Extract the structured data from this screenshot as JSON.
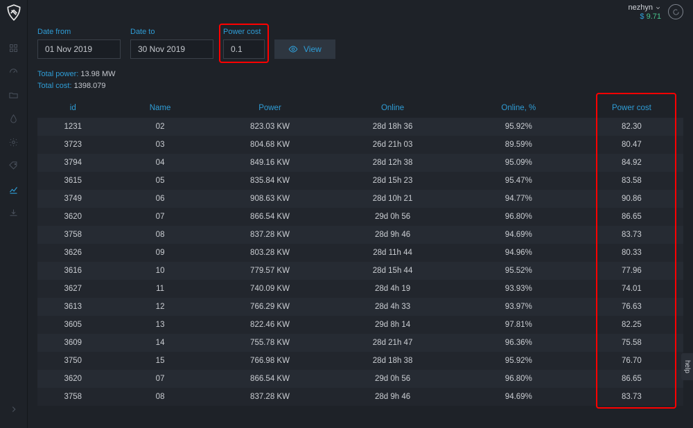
{
  "user": {
    "name": "nezhyn",
    "balance": "9.71"
  },
  "filters": {
    "date_from": {
      "label": "Date from",
      "value": "01 Nov 2019"
    },
    "date_to": {
      "label": "Date to",
      "value": "30 Nov 2019"
    },
    "power_cost": {
      "label": "Power cost",
      "value": "0.1"
    },
    "view_label": "View"
  },
  "totals": {
    "power_label": "Total power:",
    "power_value": "13.98 MW",
    "cost_label": "Total cost:",
    "cost_value": "1398.079"
  },
  "columns": {
    "id": "id",
    "name": "Name",
    "power": "Power",
    "online": "Online",
    "online_pct": "Online, %",
    "power_cost": "Power cost"
  },
  "rows": [
    {
      "id": "1231",
      "name": "02",
      "power": "823.03 KW",
      "online": "28d 18h 36",
      "pct": "95.92%",
      "cost": "82.30"
    },
    {
      "id": "3723",
      "name": "03",
      "power": "804.68 KW",
      "online": "26d 21h 03",
      "pct": "89.59%",
      "cost": "80.47"
    },
    {
      "id": "3794",
      "name": "04",
      "power": "849.16 KW",
      "online": "28d 12h 38",
      "pct": "95.09%",
      "cost": "84.92"
    },
    {
      "id": "3615",
      "name": "05",
      "power": "835.84 KW",
      "online": "28d 15h 23",
      "pct": "95.47%",
      "cost": "83.58"
    },
    {
      "id": "3749",
      "name": "06",
      "power": "908.63 KW",
      "online": "28d 10h 21",
      "pct": "94.77%",
      "cost": "90.86"
    },
    {
      "id": "3620",
      "name": "07",
      "power": "866.54 KW",
      "online": "29d 0h 56",
      "pct": "96.80%",
      "cost": "86.65"
    },
    {
      "id": "3758",
      "name": "08",
      "power": "837.28 KW",
      "online": "28d 9h 46",
      "pct": "94.69%",
      "cost": "83.73"
    },
    {
      "id": "3626",
      "name": "09",
      "power": "803.28 KW",
      "online": "28d 11h 44",
      "pct": "94.96%",
      "cost": "80.33"
    },
    {
      "id": "3616",
      "name": "10",
      "power": "779.57 KW",
      "online": "28d 15h 44",
      "pct": "95.52%",
      "cost": "77.96"
    },
    {
      "id": "3627",
      "name": "11",
      "power": "740.09 KW",
      "online": "28d 4h 19",
      "pct": "93.93%",
      "cost": "74.01"
    },
    {
      "id": "3613",
      "name": "12",
      "power": "766.29 KW",
      "online": "28d 4h 33",
      "pct": "93.97%",
      "cost": "76.63"
    },
    {
      "id": "3605",
      "name": "13",
      "power": "822.46 KW",
      "online": "29d 8h 14",
      "pct": "97.81%",
      "cost": "82.25"
    },
    {
      "id": "3609",
      "name": "14",
      "power": "755.78 KW",
      "online": "28d 21h 47",
      "pct": "96.36%",
      "cost": "75.58"
    },
    {
      "id": "3750",
      "name": "15",
      "power": "766.98 KW",
      "online": "28d 18h 38",
      "pct": "95.92%",
      "cost": "76.70"
    },
    {
      "id": "3620",
      "name": "07",
      "power": "866.54 KW",
      "online": "29d 0h 56",
      "pct": "96.80%",
      "cost": "86.65"
    },
    {
      "id": "3758",
      "name": "08",
      "power": "837.28 KW",
      "online": "28d 9h 46",
      "pct": "94.69%",
      "cost": "83.73"
    }
  ],
  "help_label": "help"
}
